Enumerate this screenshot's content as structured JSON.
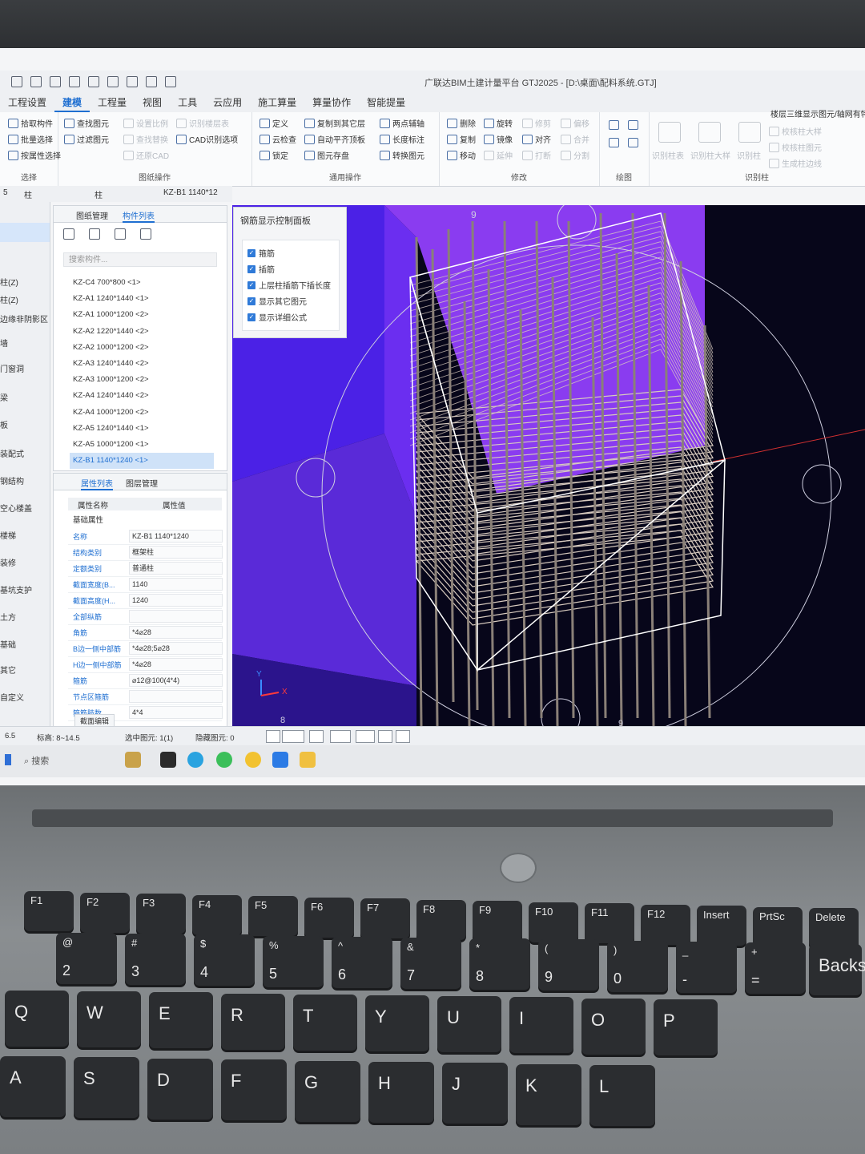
{
  "app": {
    "title": "广联达BIM土建计量平台 GTJ2025 - [D:\\桌面\\配料系统.GTJ]"
  },
  "menu": [
    "工程设置",
    "建模",
    "工程量",
    "视图",
    "工具",
    "云应用",
    "施工算量",
    "算量协作",
    "智能提量"
  ],
  "ribbon": {
    "select": {
      "title": "选择",
      "items": [
        "拾取构件",
        "批量选择",
        "按属性选择"
      ]
    },
    "drawing": {
      "title": "图纸操作",
      "items": [
        "查找图元",
        "过滤图元",
        "设置比例",
        "查找替换",
        "还原CAD",
        "识别楼层表",
        "CAD识别选项"
      ]
    },
    "general": {
      "title": "通用操作",
      "items": [
        "定义",
        "云检查",
        "锁定",
        "复制到其它层",
        "自动平齐顶板",
        "图元存盘",
        "两点辅轴",
        "长度标注",
        "转换图元"
      ]
    },
    "modify": {
      "title": "修改",
      "items": [
        "删除",
        "复制",
        "移动",
        "旋转",
        "镜像",
        "延伸",
        "修剪",
        "对齐",
        "打断",
        "偏移",
        "合并",
        "分割"
      ]
    },
    "draw": {
      "title": "绘图"
    },
    "recognize": {
      "title": "识别柱",
      "items": [
        "识别柱表",
        "识别柱大样",
        "识别柱",
        "校核柱大样",
        "校核柱图元",
        "生成柱边线"
      ],
      "header": "楼层三维显示图元/轴网有特"
    }
  },
  "filter": {
    "a": "5",
    "b": "柱",
    "c": "柱",
    "d": "KZ-B1 1140*12"
  },
  "leftnav": [
    "柱(Z)",
    "柱(Z)",
    "边缘非阴影区",
    "墙",
    "门窗洞",
    "梁",
    "板",
    "装配式",
    "钢结构",
    "空心楼盖",
    "楼梯",
    "装修",
    "基坑支护",
    "土方",
    "基础",
    "其它",
    "自定义"
  ],
  "component_panel": {
    "tabs": [
      "图纸管理",
      "构件列表"
    ],
    "search_placeholder": "搜索构件...",
    "items": [
      "KZ-C4 700*800 <1>",
      "KZ-A1 1240*1440 <1>",
      "KZ-A1 1000*1200 <2>",
      "KZ-A2 1220*1440 <2>",
      "KZ-A2 1000*1200 <2>",
      "KZ-A3 1240*1440 <2>",
      "KZ-A3 1000*1200 <2>",
      "KZ-A4 1240*1440 <2>",
      "KZ-A4 1000*1200 <2>",
      "KZ-A5 1240*1440 <1>",
      "KZ-A5 1000*1200 <1>",
      "KZ-B1 1140*1240 <1>"
    ],
    "selected_index": 11
  },
  "property_panel": {
    "tabs": [
      "属性列表",
      "图层管理"
    ],
    "col_name": "属性名称",
    "col_value": "属性值",
    "group": "基础属性",
    "rows": [
      {
        "k": "名称",
        "v": "KZ-B1 1140*1240"
      },
      {
        "k": "结构类别",
        "v": "框架柱"
      },
      {
        "k": "定额类别",
        "v": "普通柱"
      },
      {
        "k": "截面宽度(B...",
        "v": "1140"
      },
      {
        "k": "截面高度(H...",
        "v": "1240"
      },
      {
        "k": "全部纵筋",
        "v": ""
      },
      {
        "k": "角筋",
        "v": "*4⌀28"
      },
      {
        "k": "B边一侧中部筋",
        "v": "*4⌀28;5⌀28"
      },
      {
        "k": "H边一侧中部筋",
        "v": "*4⌀28"
      },
      {
        "k": "箍筋",
        "v": "⌀12@100(4*4)"
      },
      {
        "k": "节点区箍筋",
        "v": ""
      },
      {
        "k": "箍筋肢数",
        "v": "4*4"
      }
    ],
    "button": "截面编辑"
  },
  "rebar_panel": {
    "title": "钢筋显示控制面板",
    "options": [
      "箍筋",
      "插筋",
      "上层柱插筋下插长度",
      "显示其它图元",
      "显示详细公式"
    ]
  },
  "viewport": {
    "label_top": "9",
    "label_bottom": "8",
    "label_br": "9"
  },
  "status": {
    "scale": "6.5",
    "elevation": "标高: 8~14.5",
    "selected": "选中图元: 1(1)",
    "hidden": "隐藏图元: 0"
  },
  "taskbar": {
    "search": "搜索"
  },
  "keyboard": {
    "frow": [
      "F1",
      "F2",
      "F3",
      "F4",
      "F5",
      "F6",
      "F7",
      "F8",
      "F9",
      "F10",
      "F11",
      "F12",
      "Insert",
      "PrtSc",
      "Delete"
    ],
    "num": [
      [
        "@",
        "2"
      ],
      [
        "#",
        "3"
      ],
      [
        "$",
        "4"
      ],
      [
        "%",
        "5"
      ],
      [
        "^",
        "6"
      ],
      [
        "&",
        "7"
      ],
      [
        "*",
        "8"
      ],
      [
        "(",
        "9"
      ],
      [
        ")",
        "0"
      ],
      [
        "_",
        "-"
      ],
      [
        "+",
        "="
      ]
    ],
    "qrow": [
      "Q",
      "W",
      "E",
      "R",
      "T",
      "Y",
      "U",
      "I",
      "O",
      "P"
    ],
    "arow": [
      "A",
      "S",
      "D",
      "F",
      "G",
      "H",
      "J",
      "K",
      "L"
    ],
    "backspace": "Backspace"
  },
  "colors": {
    "accent": "#1f6fd1",
    "viewport_bg": "#07061a",
    "concrete": "#7b3cf0",
    "rebar": "#d8cbbf"
  }
}
